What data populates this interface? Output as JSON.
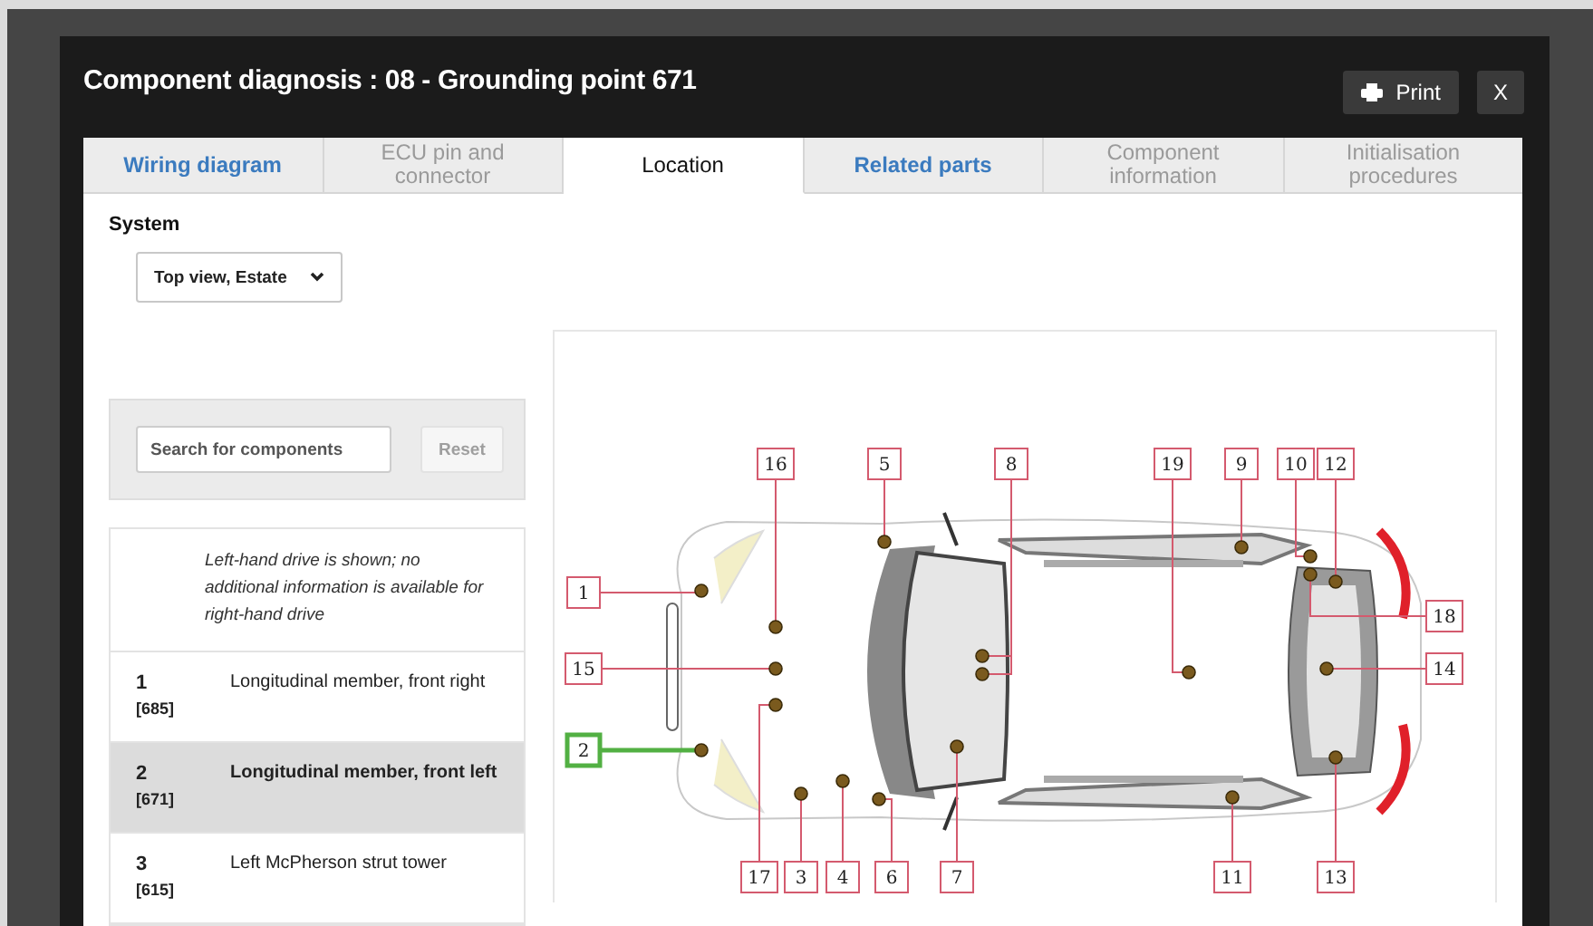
{
  "dialog": {
    "title": "Component diagnosis : 08 - Grounding point 671",
    "buttons": [
      {
        "kind": "print",
        "label": "Print"
      },
      {
        "kind": "close",
        "label": "X"
      }
    ]
  },
  "tabs": [
    {
      "label": "Wiring diagram",
      "selected": false,
      "disabled": false
    },
    {
      "label": "ECU pin and connector",
      "selected": false,
      "disabled": true
    },
    {
      "label": "Location",
      "selected": true,
      "disabled": false
    },
    {
      "label": "Related parts",
      "selected": false,
      "disabled": false
    },
    {
      "label": "Component information",
      "selected": false,
      "disabled": true
    },
    {
      "label": "Initialisation procedures",
      "selected": false,
      "disabled": true
    }
  ],
  "system": {
    "label": "System",
    "value": "Top view, Estate"
  },
  "search": {
    "placeholder": "Search for components",
    "reset": {
      "label": "Reset",
      "disabled": true
    }
  },
  "components": {
    "note": "Left-hand drive is shown; no additional information is available for right-hand drive",
    "items": [
      {
        "number": "1",
        "code": "[685]",
        "name": "Longitudinal member, front right",
        "selected": false
      },
      {
        "number": "2",
        "code": "[671]",
        "name": "Longitudinal member, front left",
        "selected": true
      },
      {
        "number": "3",
        "code": "[615]",
        "name": "Left McPherson strut tower",
        "selected": false
      }
    ]
  },
  "diagram": {
    "callouts": [
      {
        "label": "1",
        "selected": false
      },
      {
        "label": "2",
        "selected": true
      },
      {
        "label": "3",
        "selected": false
      },
      {
        "label": "4",
        "selected": false
      },
      {
        "label": "5",
        "selected": false
      },
      {
        "label": "6",
        "selected": false
      },
      {
        "label": "7",
        "selected": false
      },
      {
        "label": "8",
        "selected": false
      },
      {
        "label": "9",
        "selected": false
      },
      {
        "label": "10",
        "selected": false
      },
      {
        "label": "11",
        "selected": false
      },
      {
        "label": "12",
        "selected": false
      },
      {
        "label": "13",
        "selected": false
      },
      {
        "label": "14",
        "selected": false
      },
      {
        "label": "15",
        "selected": false
      },
      {
        "label": "16",
        "selected": false
      },
      {
        "label": "17",
        "selected": false
      },
      {
        "label": "18",
        "selected": false
      },
      {
        "label": "19",
        "selected": false
      }
    ]
  }
}
